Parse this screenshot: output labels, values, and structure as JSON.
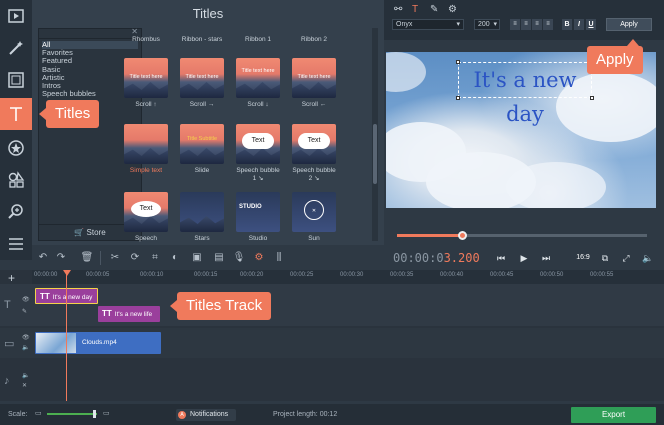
{
  "panel": {
    "title": "Titles"
  },
  "categories": {
    "items": [
      "All",
      "Favorites",
      "Featured",
      "Basic",
      "Artistic",
      "Intros",
      "Speech bubbles"
    ],
    "selected": "All",
    "store_label": "Store"
  },
  "tiles": [
    {
      "label": "Rhombus",
      "text": ""
    },
    {
      "label": "Ribbon - stars",
      "text": ""
    },
    {
      "label": "Ribbon 1",
      "text": ""
    },
    {
      "label": "Ribbon 2",
      "text": ""
    },
    {
      "label": "Scroll ↑",
      "text": "Title text here"
    },
    {
      "label": "Scroll →",
      "text": "Title text here"
    },
    {
      "label": "Scroll ↓",
      "text": "Title text here"
    },
    {
      "label": "Scroll ←",
      "text": "Title text here"
    },
    {
      "label": "Simple text",
      "text": ""
    },
    {
      "label": "Slide",
      "text": "Title Subtitle"
    },
    {
      "label": "Speech bubble 1 ↘",
      "text": "Text"
    },
    {
      "label": "Speech bubble 2 ↘",
      "text": "Text"
    },
    {
      "label": "Speech",
      "text": "Text"
    },
    {
      "label": "Stars",
      "text": ""
    },
    {
      "label": "Studio",
      "text": "STUDIO"
    },
    {
      "label": "Sun",
      "text": ""
    }
  ],
  "format": {
    "font": "Onyx",
    "size": "200",
    "apply_label": "Apply"
  },
  "preview": {
    "text": "It's a new day"
  },
  "player": {
    "time_dim": "00:00:0",
    "time_hot": "3.200",
    "ratio": "16:9"
  },
  "ruler": [
    "00:00:00",
    "00:00:05",
    "00:00:10",
    "00:00:15",
    "00:00:20",
    "00:00:25",
    "00:00:30",
    "00:00:35",
    "00:00:40",
    "00:00:45",
    "00:00:50",
    "00:00:55"
  ],
  "tracks": {
    "title_clip_1": "It's a new day",
    "title_clip_2": "It's a new life",
    "video_clip": "Clouds.mp4"
  },
  "status": {
    "scale_label": "Scale:",
    "notifications": "Notifications",
    "project_length": "Project length:  00:12",
    "export_label": "Export"
  },
  "callouts": {
    "titles": "Titles",
    "track": "Titles Track",
    "apply": "Apply"
  },
  "colors": {
    "accent": "#f07a5c",
    "export": "#2f9e57",
    "clip": "#9a3f9c",
    "video": "#3e6ec2"
  }
}
